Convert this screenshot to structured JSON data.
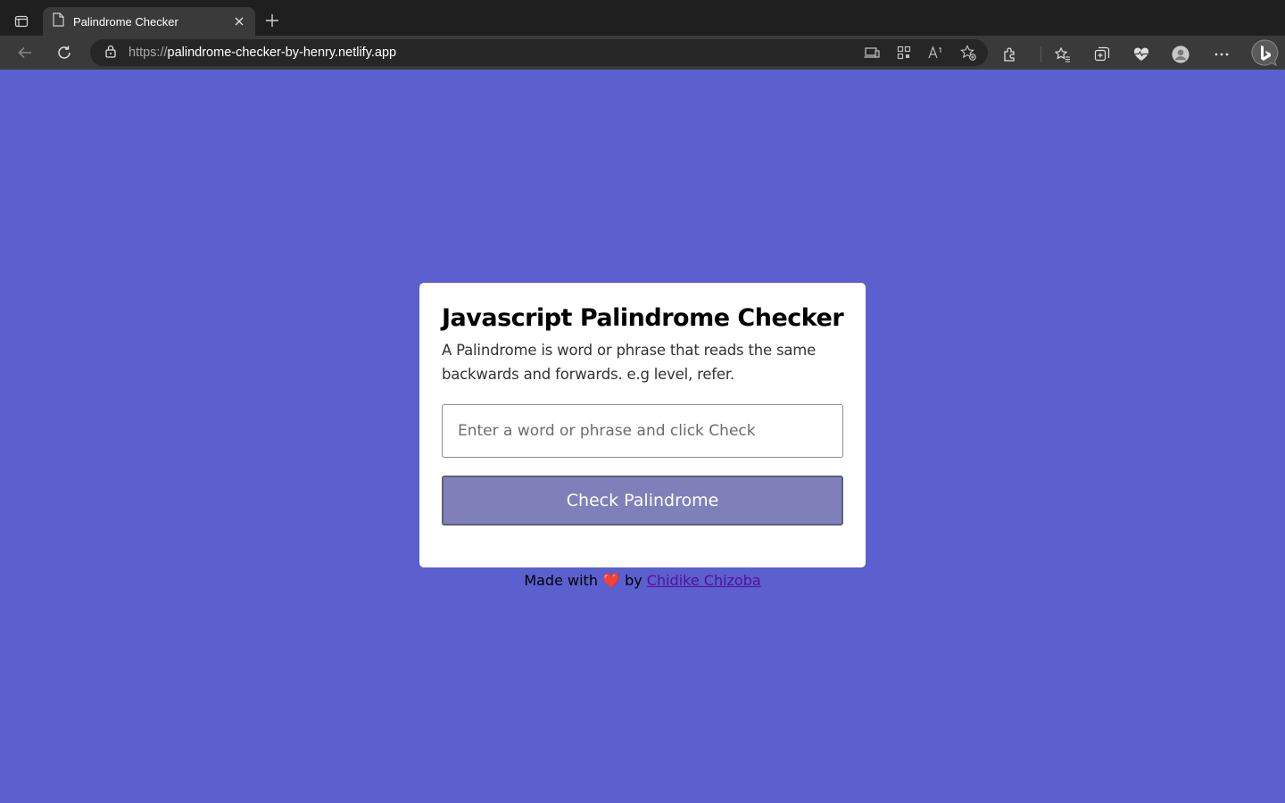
{
  "browser": {
    "tab_title": "Palindrome Checker",
    "url_protocol": "https://",
    "url_host": "palindrome-checker-by-henry.netlify.app"
  },
  "page": {
    "title": "Javascript Palindrome Checker",
    "description": "A Palindrome is word or phrase that reads the same backwards and forwards. e.g level, refer.",
    "input_placeholder": "Enter a word or phrase and click Check",
    "input_value": "",
    "button_label": "Check Palindrome"
  },
  "footer": {
    "prefix": "Made with",
    "heart": "❤️",
    "by": "by",
    "author": "Chidike Chizoba"
  },
  "colors": {
    "background": "#5c5fce",
    "card": "#ffffff",
    "button": "#7f80b9",
    "link": "#53109b",
    "heart": "#e0182d"
  }
}
